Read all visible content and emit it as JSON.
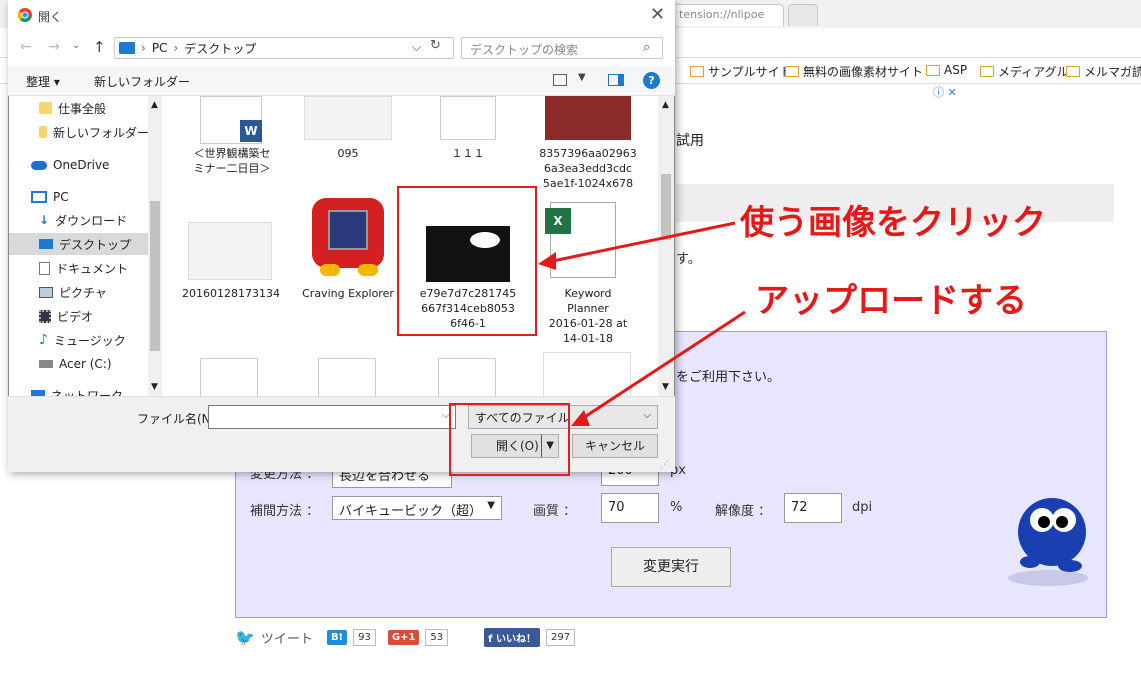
{
  "browser": {
    "tab_url_fragment": "tension://nlipoe",
    "bookmarks": [
      "サンプルサイト",
      "無料の画像素材サイト",
      "ASP",
      "メディアグル",
      "メルマガ読者"
    ]
  },
  "page": {
    "trial_text": "試用",
    "desu_text": "す。",
    "panel_intro": "をご利用下さい。",
    "change_method_label": "変更方法 ：",
    "change_method_value": "長辺を合わせる",
    "size_value": "200",
    "size_unit": "px",
    "interp_label": "補間方法 ：",
    "interp_value": "バイキュービック（超）",
    "quality_label": "画質 ：",
    "quality_value": "70",
    "quality_unit": "%",
    "resolution_label": "解像度 ：",
    "resolution_value": "72",
    "resolution_unit": "dpi",
    "exec_button": "変更実行"
  },
  "share": {
    "tweet": "ツイート",
    "hatena_count": "93",
    "gplus_label": "G+1",
    "gplus_count": "53",
    "fb_label": "いいね！",
    "fb_count": "297"
  },
  "dialog": {
    "title": "開く",
    "breadcrumb": [
      "PC",
      "デスクトップ"
    ],
    "search_placeholder": "デスクトップの検索",
    "organize": "整理 ▾",
    "new_folder": "新しいフォルダー",
    "nav_items": [
      {
        "label": "仕事全般",
        "icon": "folder-icon"
      },
      {
        "label": "新しいフォルダー",
        "icon": "folder-icon"
      },
      {
        "label": "OneDrive",
        "icon": "cloud-icon"
      },
      {
        "label": "PC",
        "icon": "computer-icon"
      },
      {
        "label": "ダウンロード",
        "icon": "download-icon"
      },
      {
        "label": "デスクトップ",
        "icon": "desktop-icon",
        "selected": true
      },
      {
        "label": "ドキュメント",
        "icon": "document-icon"
      },
      {
        "label": "ピクチャ",
        "icon": "picture-icon"
      },
      {
        "label": "ビデオ",
        "icon": "video-icon"
      },
      {
        "label": "ミュージック",
        "icon": "music-icon"
      },
      {
        "label": "Acer (C:)",
        "icon": "drive-icon"
      },
      {
        "label": "ネットワーク",
        "icon": "network-icon"
      }
    ],
    "files_row1": [
      "＜世界観構築セ\nミナー二日目＞",
      "095",
      "１１１",
      "8357396aa02963\n6a3ea3edd3cdc\n5ae1f-1024x678"
    ],
    "files_row2": [
      "20160128173134",
      "Craving Explorer",
      "e79e7d7c281745\n667f314ceb8053\n6f46-1",
      "Keyword\nPlanner\n2016-01-28 at\n14-01-18"
    ],
    "filename_label": "ファイル名(N):",
    "filename_value": "",
    "filetype": "すべてのファイル",
    "open_button": "開く(O)",
    "cancel_button": "キャンセル"
  },
  "annotations": {
    "click_image": "使う画像をクリック",
    "upload": "アップロードする"
  },
  "colors": {
    "annotation_red": "#e61919",
    "panel_bg": "#e8e6ff",
    "accent_blue": "#0078d7"
  }
}
